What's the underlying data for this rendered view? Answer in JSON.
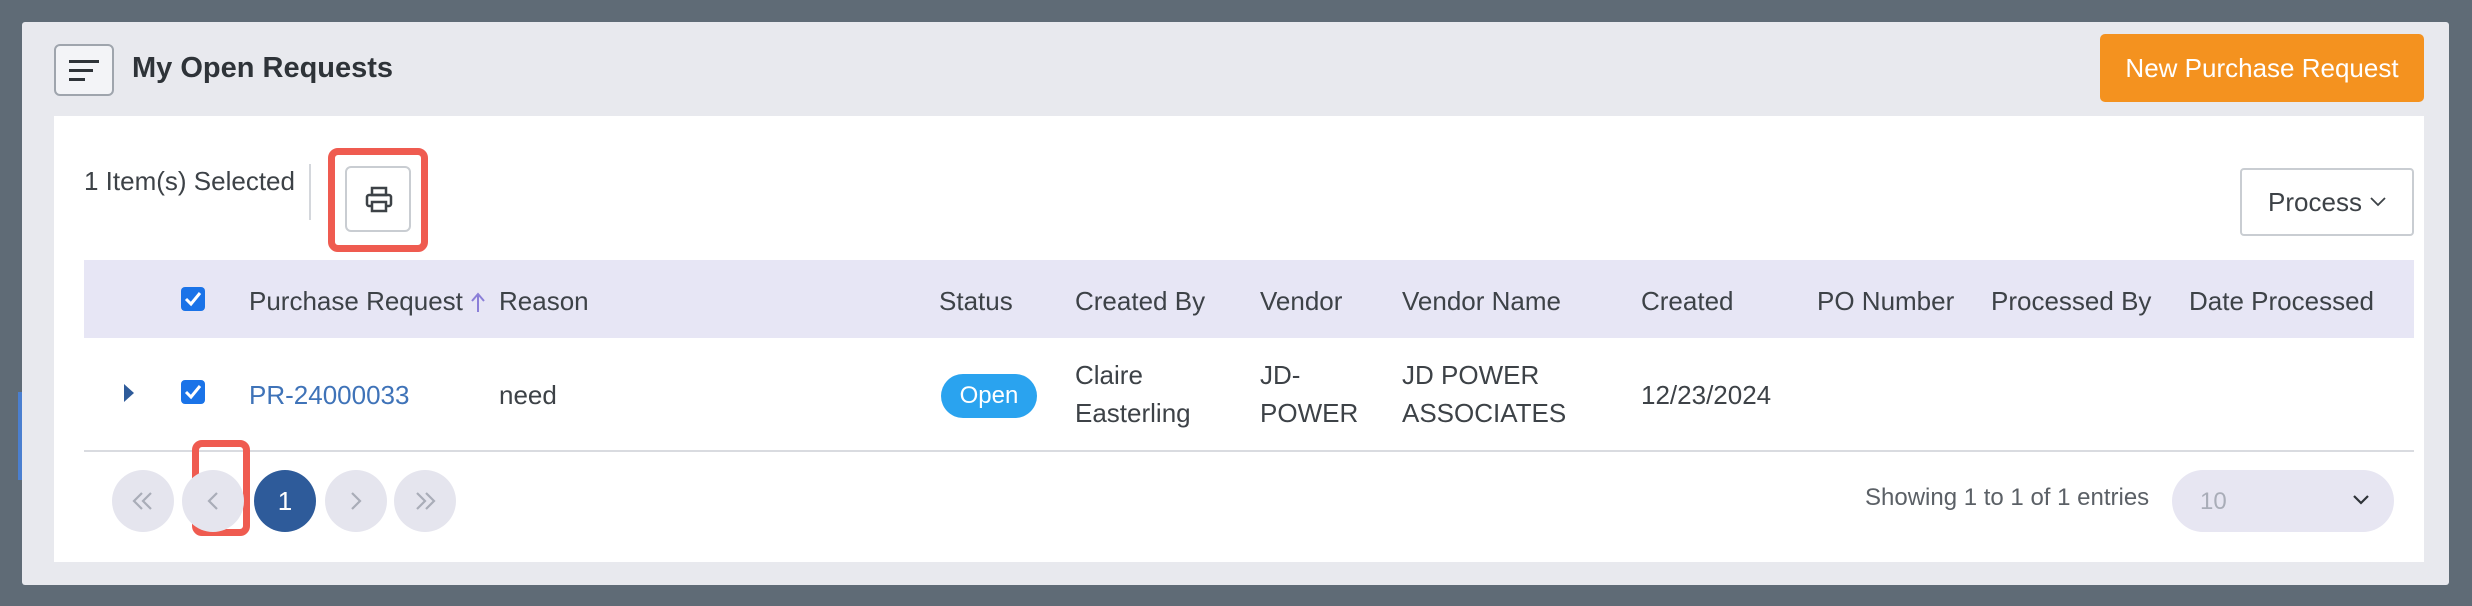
{
  "header": {
    "title": "My Open Requests",
    "new_button_label": "New Purchase Request"
  },
  "toolbar": {
    "selected_text": "1 Item(s) Selected",
    "print_icon": "printer-icon",
    "process_label": "Process"
  },
  "table": {
    "columns": [
      "Purchase Request",
      "Reason",
      "Status",
      "Created By",
      "Vendor",
      "Vendor Name",
      "Created",
      "PO Number",
      "Processed By",
      "Date Processed"
    ],
    "rows": [
      {
        "purchase_request": "PR-24000033",
        "reason": "need",
        "status": "Open",
        "created_by_line1": "Claire",
        "created_by_line2": "Easterling",
        "vendor_line1": "JD-",
        "vendor_line2": "POWER",
        "vendor_name_line1": "JD POWER",
        "vendor_name_line2": "ASSOCIATES",
        "created": "12/23/2024",
        "po_number": "",
        "processed_by": "",
        "date_processed": ""
      }
    ]
  },
  "pagination": {
    "current_page": "1",
    "showing_text": "Showing 1 to 1 of 1 entries",
    "page_size": "10"
  },
  "colors": {
    "accent_orange": "#f4921f",
    "status_open": "#2aa3ef",
    "link": "#3f73b8",
    "highlight": "#ef5b50"
  }
}
